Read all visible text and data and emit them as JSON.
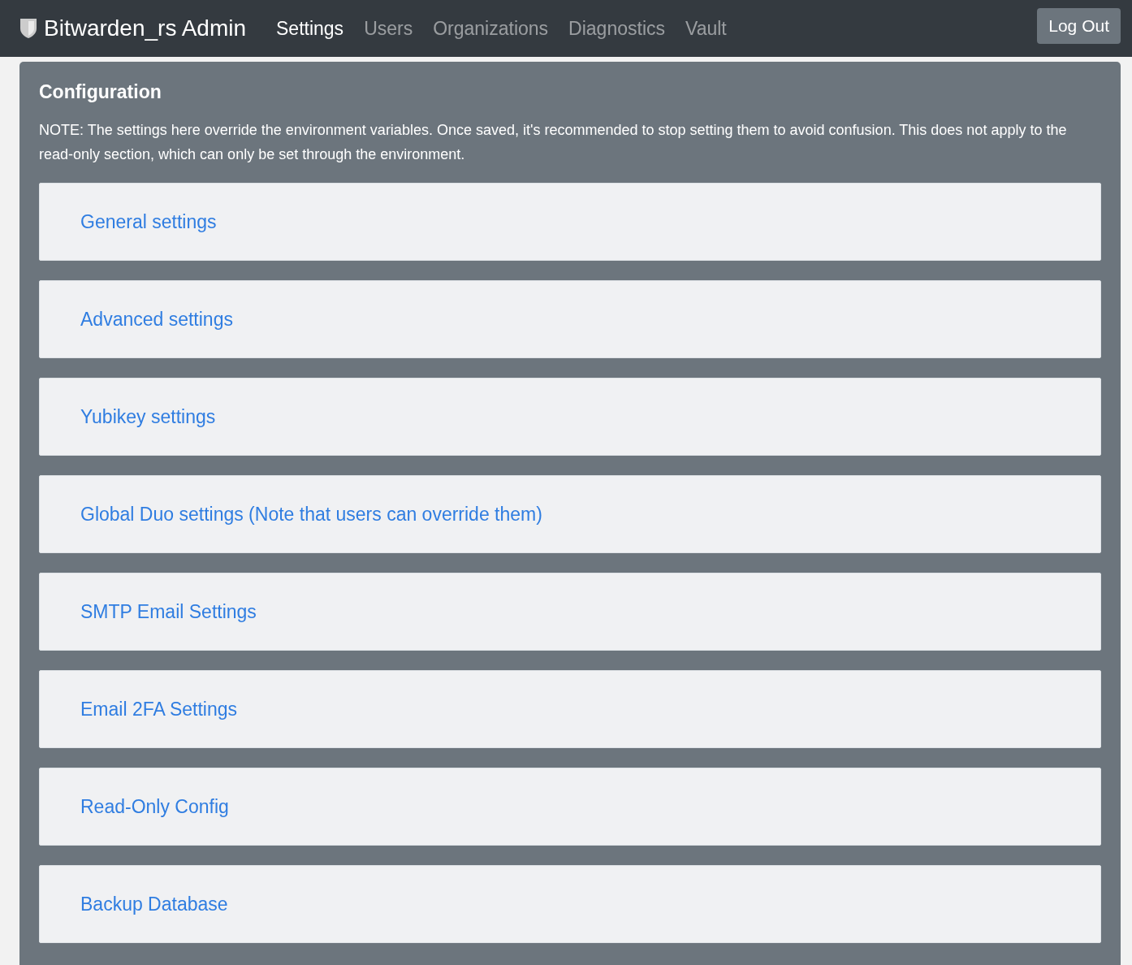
{
  "navbar": {
    "brand": "Bitwarden_rs Admin",
    "nav_items": [
      {
        "label": "Settings",
        "selected": true
      },
      {
        "label": "Users",
        "selected": false
      },
      {
        "label": "Organizations",
        "selected": false
      },
      {
        "label": "Diagnostics",
        "selected": false
      },
      {
        "label": "Vault",
        "selected": false
      }
    ],
    "logout_button": "Log Out"
  },
  "panel": {
    "title": "Configuration",
    "note": "NOTE: The settings here override the environment variables. Once saved, it's recommended to stop setting them to avoid confusion. This does not apply to the read-only section, which can only be set through the environment.",
    "sections": [
      {
        "label": "General settings"
      },
      {
        "label": "Advanced settings"
      },
      {
        "label": "Yubikey settings"
      },
      {
        "label": "Global Duo settings (Note that users can override them)"
      },
      {
        "label": "SMTP Email Settings"
      },
      {
        "label": "Email 2FA Settings"
      },
      {
        "label": "Read-Only Config"
      },
      {
        "label": "Backup Database"
      }
    ]
  }
}
